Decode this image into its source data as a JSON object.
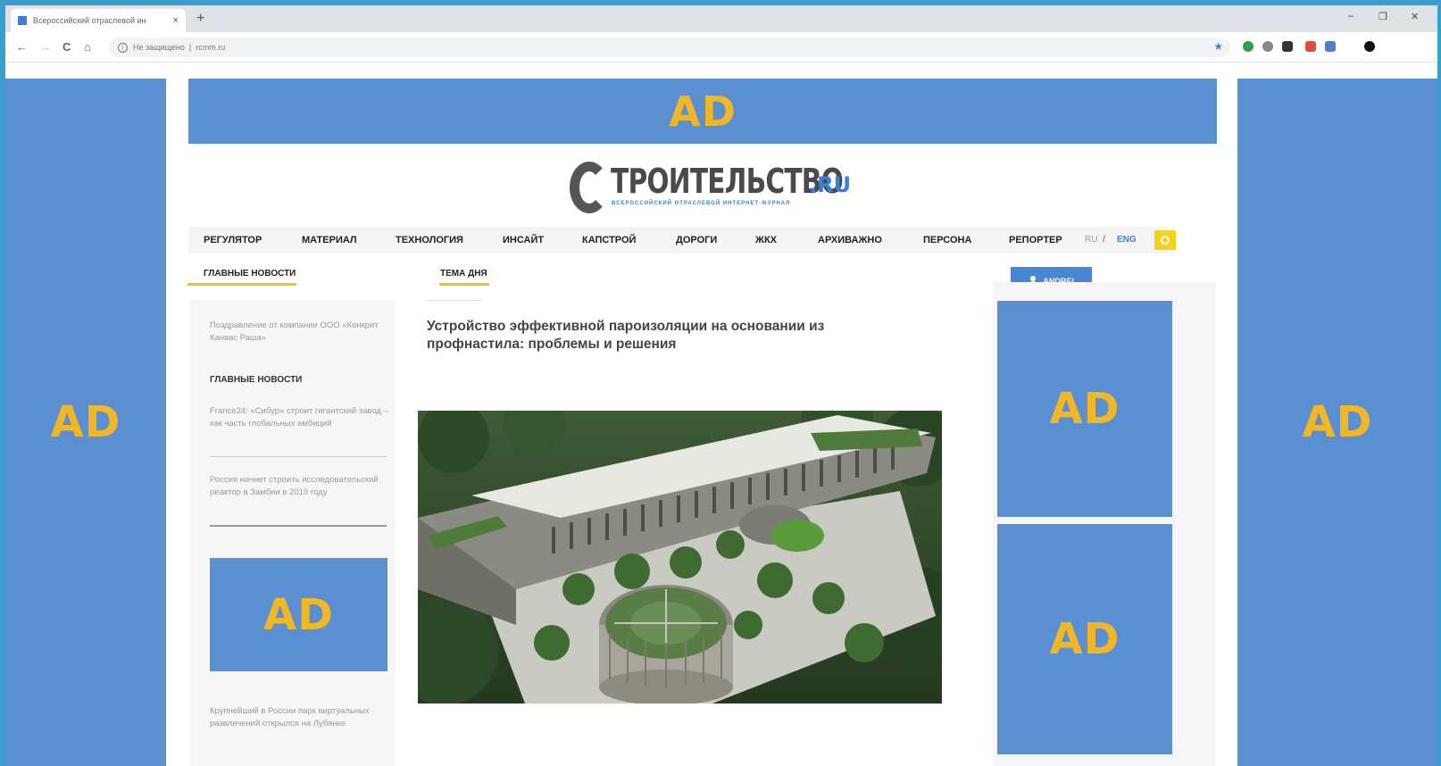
{
  "browser": {
    "tab_title": "Всероссийский отраслевой ин",
    "tab_close": "×",
    "new_tab": "+",
    "url_security": "Не защищено",
    "url_separator": "|",
    "url": "rcmm.ru",
    "win_minimize": "–",
    "win_restore": "❐",
    "win_close": "✕",
    "back": "←",
    "forward": "→",
    "reload": "C",
    "home": "⌂",
    "bookmark_star": "★"
  },
  "ads": {
    "label": "AD"
  },
  "logo": {
    "main": "ТРОИТЕЛЬСТВО",
    "domain": ".RU",
    "subtitle": "ВСЕРОССИЙСКИЙ ОТРАСЛЕВОЙ ИНТЕРНЕТ-ЖУРНАЛ"
  },
  "menu": {
    "items": [
      "РЕГУЛЯТОР",
      "МАТЕРИАЛ",
      "ТЕХНОЛОГИЯ",
      "ИНСАЙТ",
      "КАПСТРОЙ",
      "ДОРОГИ",
      "ЖКХ",
      "АРХИВАЖНО",
      "ПЕРСОНА",
      "РЕПОРТЕР"
    ],
    "lang_ru": "RU",
    "lang_sep": "/",
    "lang_eng": "ENG"
  },
  "sections": {
    "main_news": "ГЛАВНЫЕ НОВОСТИ",
    "topic_of_day": "ТЕМА ДНЯ"
  },
  "user": {
    "name": "ANDREI"
  },
  "left_column": {
    "item1": "Поздравление от компании ООО «Конкрит Канвас Раша»",
    "heading": "ГЛАВНЫЕ НОВОСТИ",
    "item2": "France24: «Сибур» строит гигантский завод – как часть глобальных амбиций",
    "item3": "Россия начнет строить исследовательский реактор в Замбии в 2019 году",
    "item4": "Крупнейший в России парк виртуальных развлечений открылся на Лубянке"
  },
  "article": {
    "title": "Устройство эффективной пароизоляции на основании из профнастила: проблемы и решения"
  },
  "colors": {
    "ad_blue": "#5a8fd2",
    "ad_text": "#f2b724",
    "accent_yellow": "#f2c21c",
    "brand_blue": "#3d7fd6",
    "background": "#3a9fd0"
  }
}
